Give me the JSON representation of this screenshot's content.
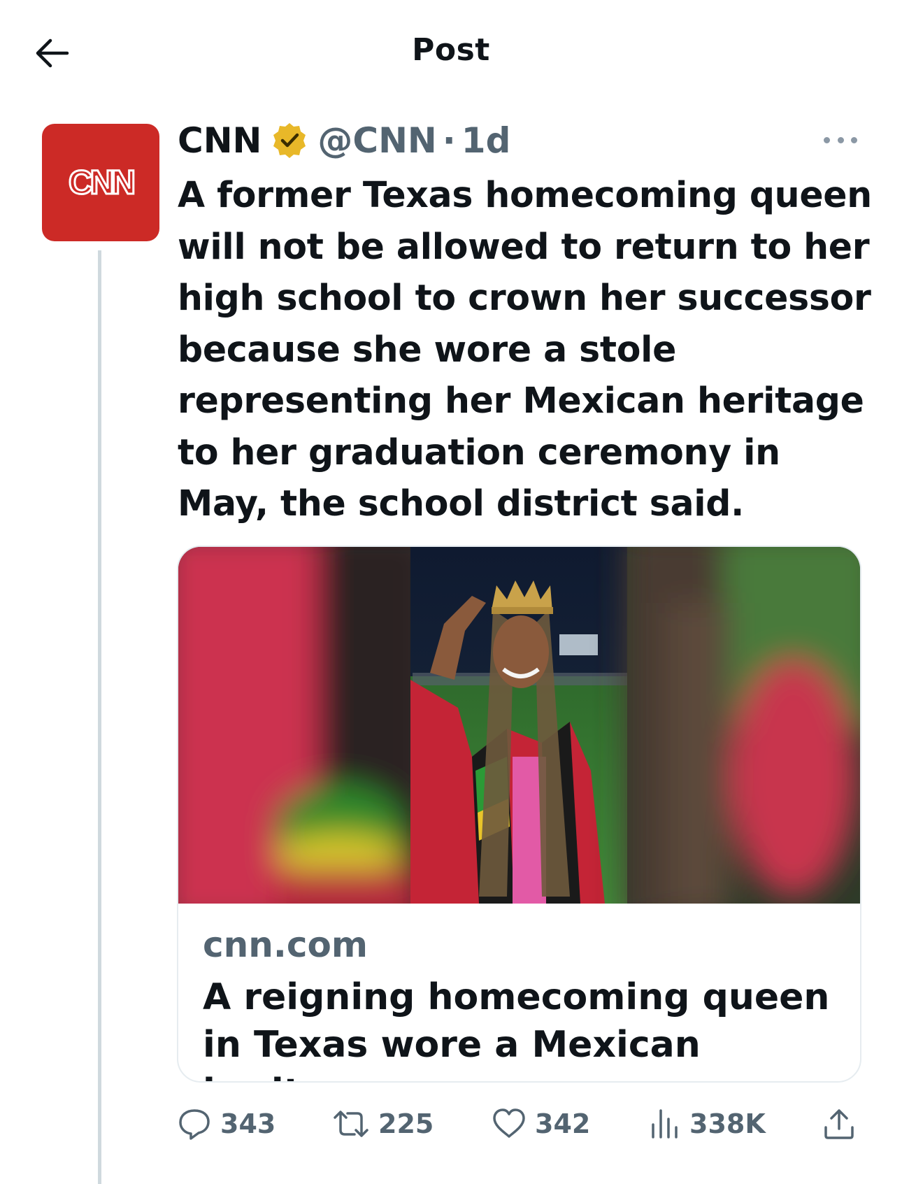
{
  "header": {
    "title": "Post"
  },
  "post": {
    "author_name": "CNN",
    "avatar_text": "CNN",
    "handle": "@CNN",
    "separator": "·",
    "time": "1d",
    "text": "A former Texas homecoming queen will not be allowed to return to her high school to crown her successor because she wore a stole representing her Mexican heritage to her graduation ceremony in May, the school district said.",
    "card": {
      "domain": "cnn.com",
      "title": "A reigning homecoming queen in Texas wore a Mexican heritage..."
    },
    "stats": {
      "replies": "343",
      "reposts": "225",
      "likes": "342",
      "views": "338K"
    }
  },
  "colors": {
    "cnn_red": "#cc2a26",
    "verified_gold": "#e8b829",
    "secondary_text": "#536471",
    "thread_line": "#cfd9de"
  },
  "icons": [
    "back-arrow-icon",
    "verified-badge-icon",
    "more-options-icon",
    "reply-icon",
    "repost-icon",
    "like-icon",
    "views-icon",
    "share-icon"
  ]
}
